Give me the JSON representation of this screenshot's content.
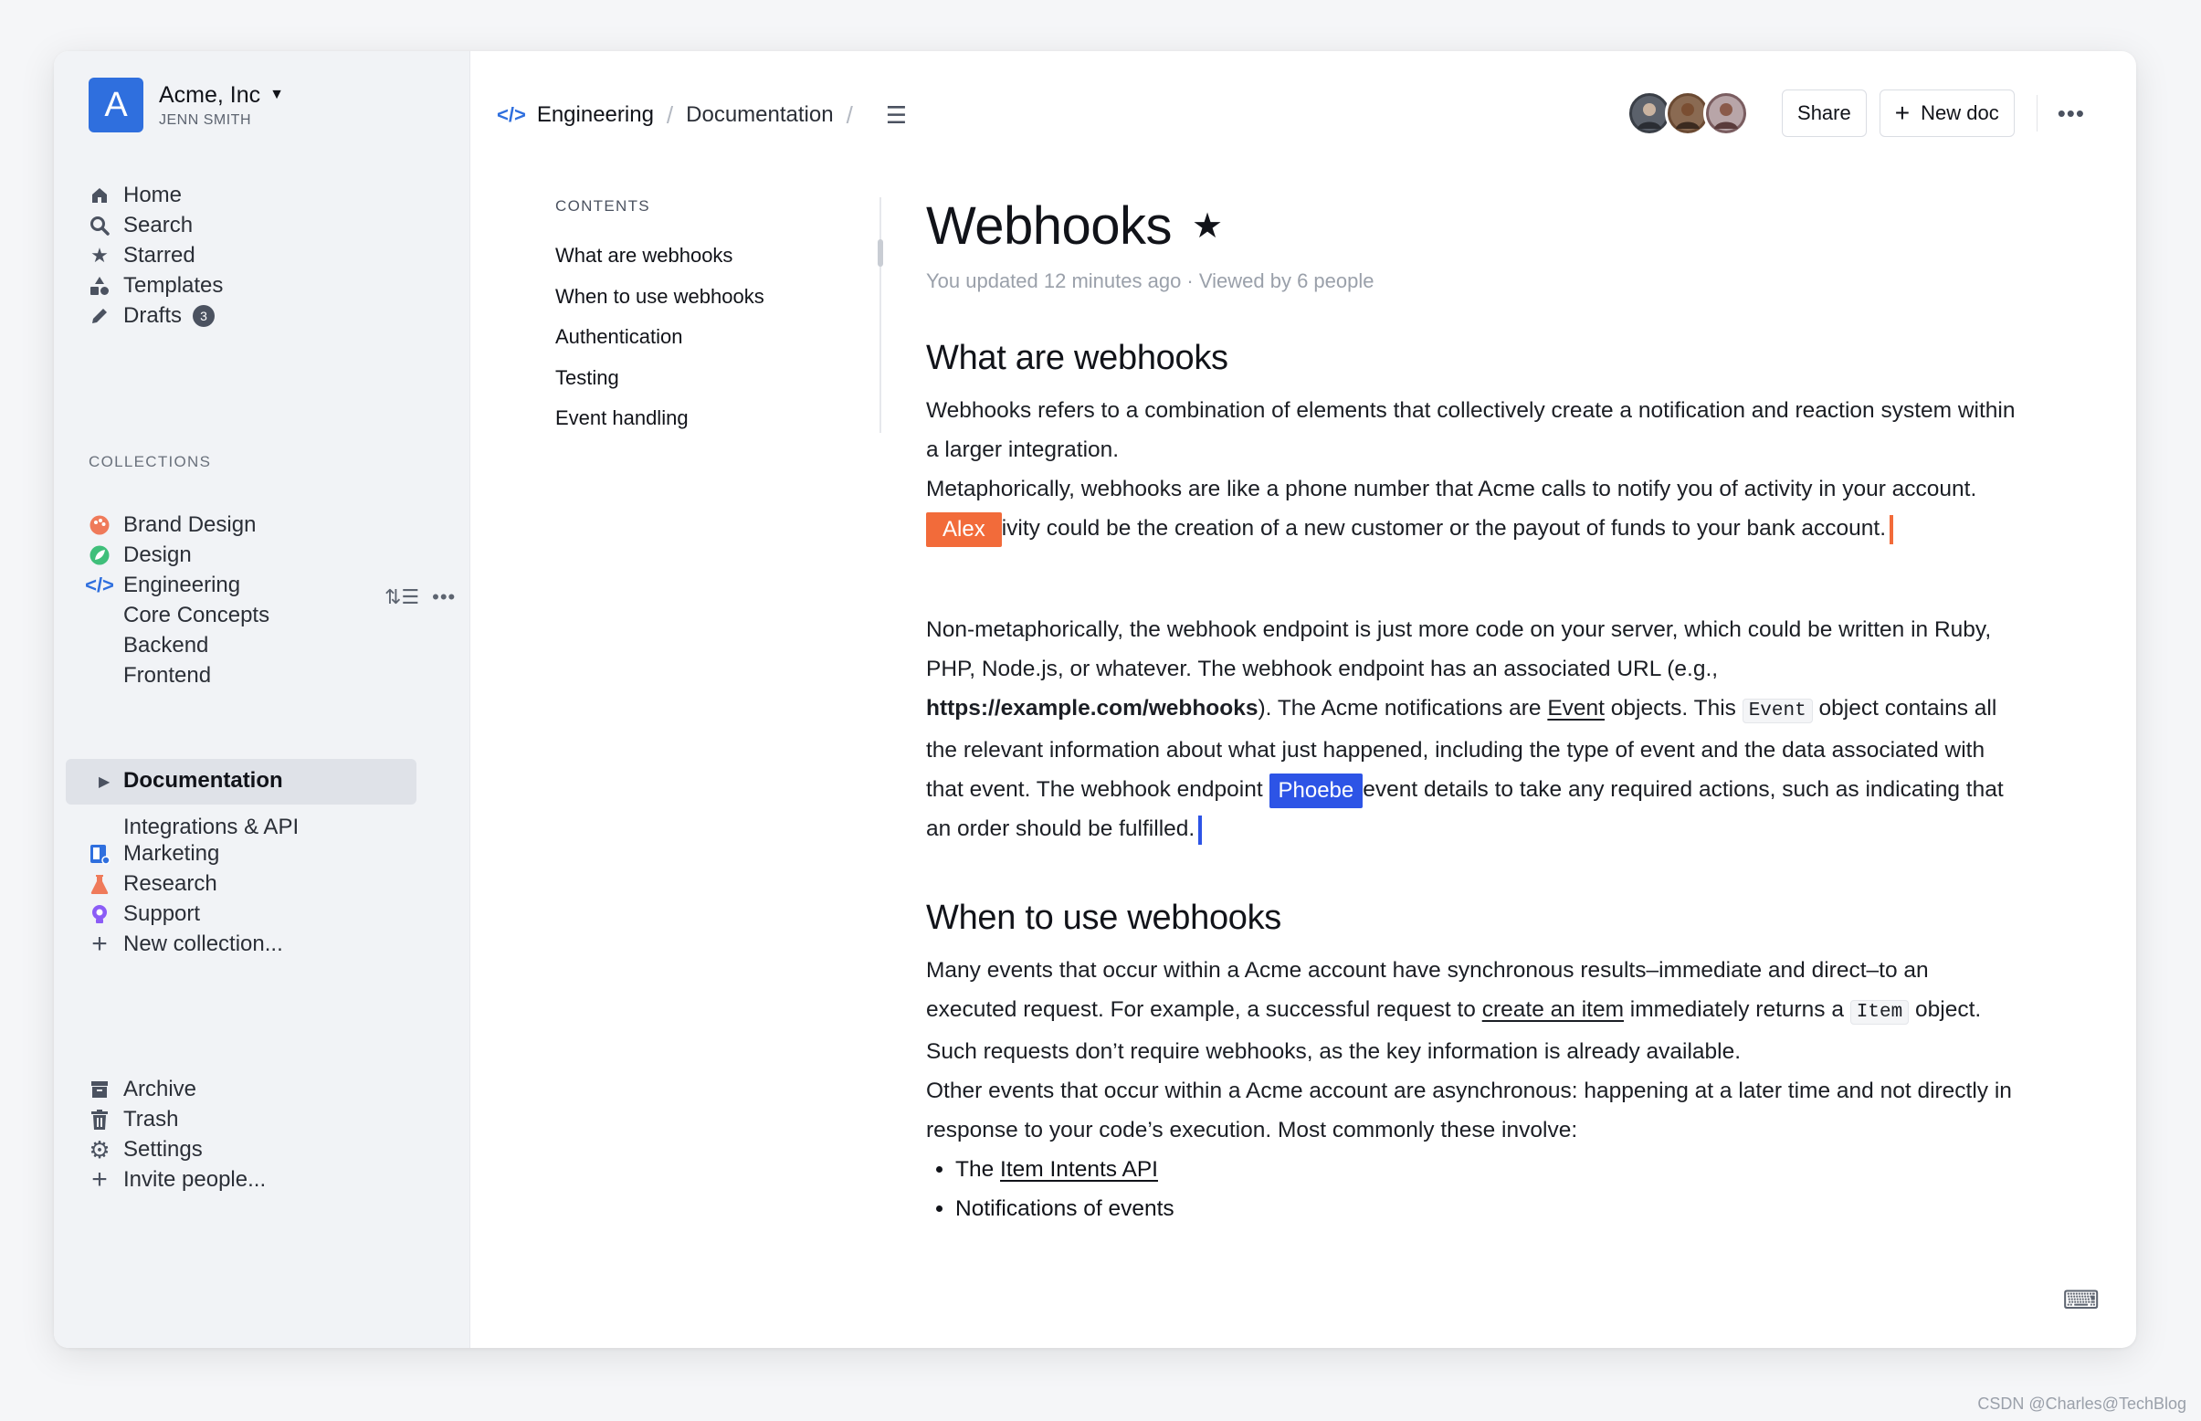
{
  "team": {
    "logo_letter": "A",
    "name": "Acme, Inc",
    "user": "JENN SMITH"
  },
  "nav": {
    "home": "Home",
    "search": "Search",
    "starred": "Starred",
    "templates": "Templates",
    "drafts": "Drafts",
    "drafts_count": "3"
  },
  "collections": {
    "label": "COLLECTIONS",
    "brand_design": "Brand Design",
    "design": "Design",
    "engineering": "Engineering",
    "core_concepts": "Core Concepts",
    "backend": "Backend",
    "frontend": "Frontend",
    "documentation": "Documentation",
    "integrations": "Integrations & API",
    "marketing": "Marketing",
    "research": "Research",
    "support": "Support",
    "new_collection": "New collection..."
  },
  "footer_nav": {
    "archive": "Archive",
    "trash": "Trash",
    "settings": "Settings",
    "invite": "Invite people..."
  },
  "breadcrumb": {
    "collection": "Engineering",
    "doc": "Documentation"
  },
  "toolbar": {
    "share": "Share",
    "new_doc": "New doc",
    "more": "•••"
  },
  "toc": {
    "title": "CONTENTS",
    "items": [
      "What are webhooks",
      "When to use webhooks",
      "Authentication",
      "Testing",
      "Event handling"
    ]
  },
  "doc": {
    "title": "Webhooks",
    "meta": "You updated 12 minutes ago · Viewed by 6 people",
    "h_what": "What are webhooks",
    "p1": "Webhooks refers to a combination of elements that collectively create a notification and reaction system within a larger integration.",
    "p2a": "Metaphorically, webhooks are like a phone number that Acme calls to notify you of activity in your account.",
    "p2b": "ivity could be the creation of a new customer or the payout of funds to your bank account.",
    "p3a": "Non-metaphorically, the webhook endpoint is just more code on your server, which could be written in Ruby, PHP, Node.js, or whatever. The webhook endpoint has an associated URL (e.g., ",
    "p3_url": "https://example.com/webhooks",
    "p3b": "). The Acme notifications are ",
    "p3_event_link": "Event",
    "p3c": " objects. This ",
    "p3_code": "Event",
    "p3d": " object contains all the relevant information about what just happened, including the type of event and the data associated with that event. The webhook endpoint ",
    "p3e": "event details to take any required actions, such as indicating that an order should be fulfilled.",
    "h_when": "When to use webhooks",
    "p4a": "Many events that occur within a Acme account have synchronous results–immediate and direct–to an executed request. For example, a successful request to ",
    "p4_link": "create an item",
    "p4b": " immediately returns a ",
    "p4_code": "Item",
    "p4c": " object. Such requests don’t require webhooks, as the key information is already available.",
    "p5": "Other events that occur within a Acme account are asynchronous: happening at a later time and not directly in response to your code’s execution. Most commonly these involve:",
    "li1_pre": "The ",
    "li1_link": "Item Intents API",
    "li2": "Notifications of events"
  },
  "collaborators": [
    {
      "name": "Alex",
      "color": "#f26b3a"
    },
    {
      "name": "Phoebe",
      "color": "#2d54e6"
    }
  ],
  "watermark": "CSDN @Charles@TechBlog"
}
